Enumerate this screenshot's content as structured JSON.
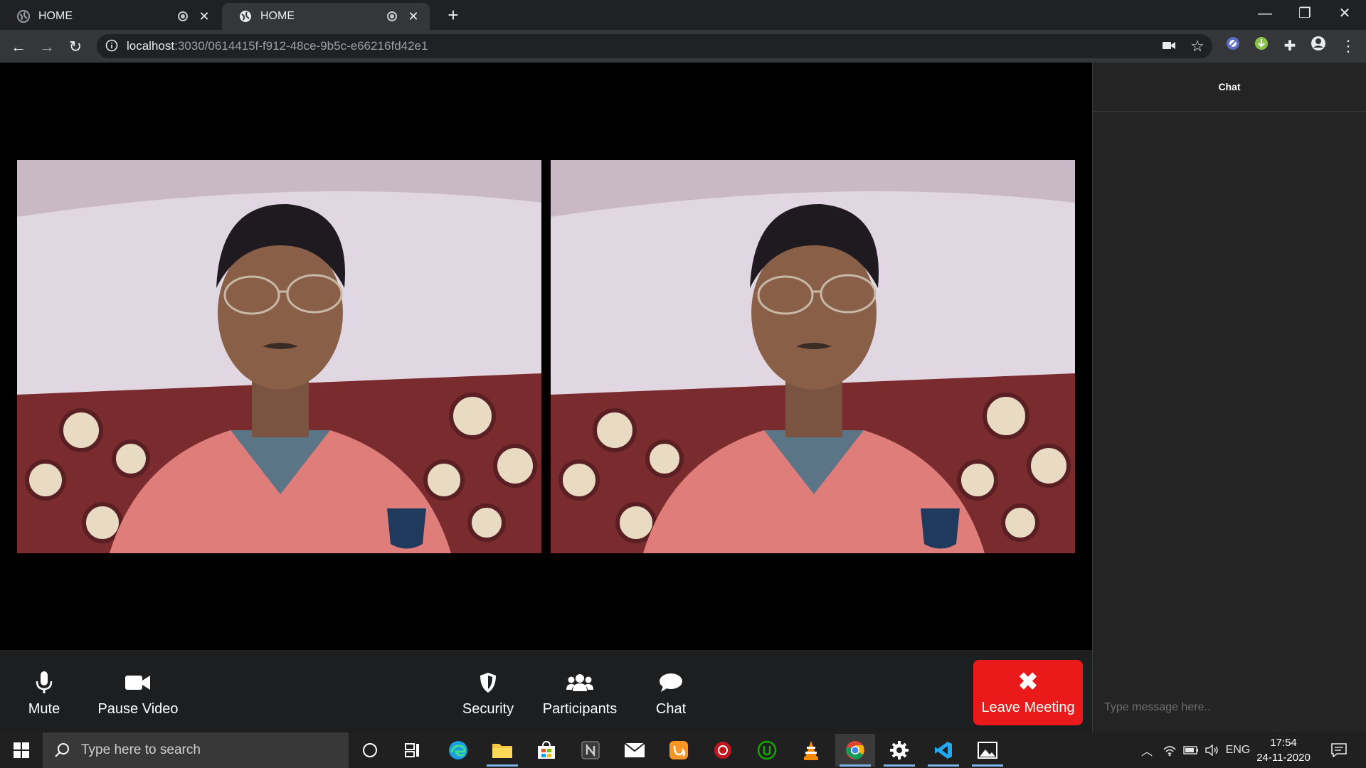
{
  "browser": {
    "tabs": [
      {
        "title": "HOME",
        "active": false
      },
      {
        "title": "HOME",
        "active": true
      }
    ],
    "url_host": "localhost",
    "url_rest": ":3030/0614415f-f912-48ce-9b5c-e66216fd42e1",
    "new_tab_symbol": "+",
    "window_controls": {
      "minimize": "—",
      "restore": "❐",
      "close": "✕"
    }
  },
  "meeting": {
    "video_tiles": [
      {
        "name": "local-video"
      },
      {
        "name": "remote-video"
      }
    ],
    "controls": {
      "mute": "Mute",
      "pause_video": "Pause Video",
      "security": "Security",
      "participants": "Participants",
      "chat": "Chat",
      "leave": "Leave Meeting"
    },
    "colors": {
      "leave_button": "#eb1a1a",
      "controls_bg": "#1c1e20",
      "chat_bg": "#242424"
    }
  },
  "chat": {
    "header": "Chat",
    "input_placeholder": "Type message here.."
  },
  "taskbar": {
    "search_placeholder": "Type here to search",
    "language": "ENG",
    "time": "17:54",
    "date": "24-11-2020"
  }
}
